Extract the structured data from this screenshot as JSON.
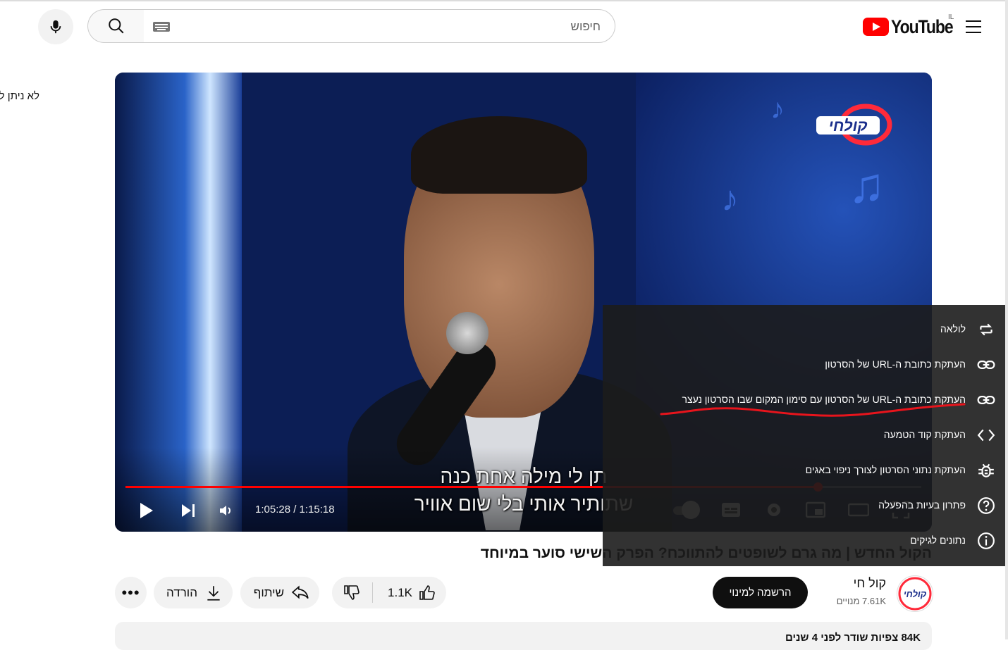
{
  "masthead": {
    "logo_text": "YouTube",
    "country_code": "IL",
    "search_placeholder": "חיפוש"
  },
  "sidebar": {
    "truncated_text": "לא ניתן לנגן"
  },
  "player": {
    "current_time": "1:05:28",
    "duration": "1:15:18",
    "time_display": "1:05:28 / 1:15:18",
    "progress_fraction": 0.8694,
    "subtitle_line1": "תן לי מילה אחת כנה",
    "subtitle_line2": "שתותיר אותי בלי שום אוויר",
    "accent_color": "#ff0000"
  },
  "video": {
    "title": "הקול החדש | מה גרם לשופטים להתווכח? הפרק השישי סוער במיוחד",
    "channel_name": "קול חי",
    "subscribers": "7.61K מנויים",
    "subscribe_label": "הרשמה למינוי",
    "like_count": "1.1K",
    "share_label": "שיתוף",
    "download_label": "הורדה",
    "description_preview": "84K צפיות  שודר לפני 4 שנים"
  },
  "context_menu": {
    "items": [
      {
        "label": "לולאה",
        "icon": "loop-icon"
      },
      {
        "label": "העתקת כתובת ה-URL של הסרטון",
        "icon": "link-icon"
      },
      {
        "label": "העתקת כתובת ה-URL של הסרטון עם סימון המקום שבו הסרטון נעצר",
        "icon": "link-icon"
      },
      {
        "label": "העתקת קוד הטמעה",
        "icon": "embed-code-icon"
      },
      {
        "label": "העתקת נתוני הסרטון לצורך ניפוי באגים",
        "icon": "bug-icon"
      },
      {
        "label": "פתרון בעיות בהפעלה",
        "icon": "help-icon"
      },
      {
        "label": "נתונים לגיקים",
        "icon": "info-icon"
      }
    ],
    "annotation_color": "#e8141c"
  }
}
